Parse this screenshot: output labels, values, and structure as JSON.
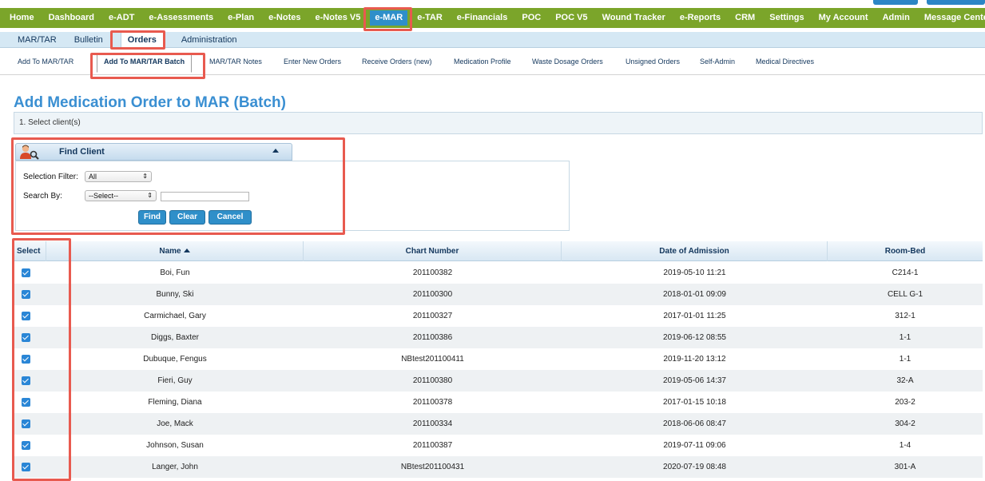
{
  "top_nav": {
    "items": [
      "Home",
      "Dashboard",
      "e-ADT",
      "e-Assessments",
      "e-Plan",
      "e-Notes",
      "e-Notes V5",
      "e-MAR",
      "e-TAR",
      "e-Financials",
      "POC",
      "POC V5",
      "Wound Tracker",
      "e-Reports",
      "CRM",
      "Settings",
      "My Account",
      "Admin",
      "Message Center"
    ],
    "active": "e-MAR",
    "color": "#7ba52a"
  },
  "sub_nav": {
    "items": [
      "MAR/TAR",
      "Bulletin",
      "Orders",
      "Administration"
    ],
    "active": "Orders"
  },
  "tabs": {
    "items": [
      "Add To MAR/TAR",
      "Add To MAR/TAR Batch",
      "MAR/TAR Notes",
      "Enter New Orders",
      "Receive Orders (new)",
      "Medication Profile",
      "Waste Dosage Orders",
      "Unsigned Orders",
      "Self-Admin",
      "Medical Directives"
    ],
    "active": "Add To MAR/TAR Batch"
  },
  "page": {
    "title": "Add Medication Order to MAR (Batch)",
    "step": "1. Select client(s)"
  },
  "find_client": {
    "title": "Find Client",
    "icon": "person-search-icon",
    "selection_filter_label": "Selection Filter:",
    "selection_filter_value": "All",
    "search_by_label": "Search By:",
    "search_by_value": "--Select--",
    "search_value": "",
    "find_label": "Find",
    "clear_label": "Clear",
    "cancel_label": "Cancel"
  },
  "table": {
    "headers": {
      "select": "Select",
      "name": "Name",
      "chart": "Chart Number",
      "admission": "Date of Admission",
      "room": "Room-Bed"
    },
    "rows": [
      {
        "name": "Boi, Fun",
        "chart": "201100382",
        "admission": "2019-05-10 11:21",
        "room": "C214-1",
        "checked": true
      },
      {
        "name": "Bunny, Ski",
        "chart": "201100300",
        "admission": "2018-01-01 09:09",
        "room": "CELL G-1",
        "checked": true
      },
      {
        "name": "Carmichael, Gary",
        "chart": "201100327",
        "admission": "2017-01-01 11:25",
        "room": "312-1",
        "checked": true
      },
      {
        "name": "Diggs, Baxter",
        "chart": "201100386",
        "admission": "2019-06-12 08:55",
        "room": "1-1",
        "checked": true
      },
      {
        "name": "Dubuque, Fengus",
        "chart": "NBtest201100411",
        "admission": "2019-11-20 13:12",
        "room": "1-1",
        "checked": true
      },
      {
        "name": "Fieri, Guy",
        "chart": "201100380",
        "admission": "2019-05-06 14:37",
        "room": "32-A",
        "checked": true
      },
      {
        "name": "Fleming, Diana",
        "chart": "201100378",
        "admission": "2017-01-15 10:18",
        "room": "203-2",
        "checked": true
      },
      {
        "name": "Joe, Mack",
        "chart": "201100334",
        "admission": "2018-06-06 08:47",
        "room": "304-2",
        "checked": true
      },
      {
        "name": "Johnson, Susan",
        "chart": "201100387",
        "admission": "2019-07-11 09:06",
        "room": "1-4",
        "checked": true
      },
      {
        "name": "Langer, John",
        "chart": "NBtest201100431",
        "admission": "2020-07-19 08:48",
        "room": "301-A",
        "checked": true
      }
    ]
  },
  "highlight_color": "#e85a4f"
}
